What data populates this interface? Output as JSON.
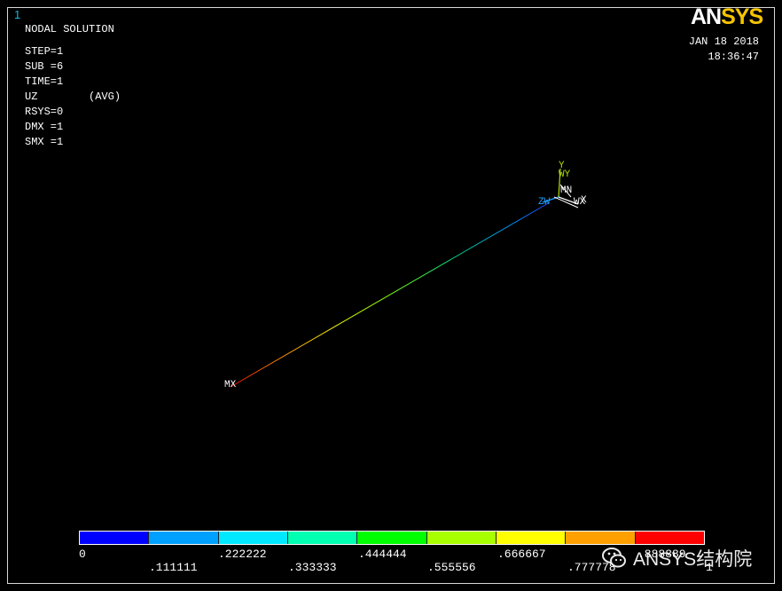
{
  "window": {
    "number": "1"
  },
  "info": {
    "title": "NODAL SOLUTION",
    "lines": [
      "STEP=1",
      "SUB =6",
      "TIME=1",
      "UZ        (AVG)",
      "RSYS=0",
      "DMX =1",
      "SMX =1"
    ]
  },
  "brand": {
    "logo_white": "AN",
    "logo_yellow": "SYS"
  },
  "datetime": {
    "date": "JAN 18 2018",
    "time": "18:36:47"
  },
  "markers": {
    "mx": "MX",
    "mn": "MN"
  },
  "triad": {
    "y": "Y",
    "wy": "WY",
    "zw": "ZW",
    "x": "X",
    "wx": "WX"
  },
  "legend": {
    "colors": [
      "#0000ff",
      "#00a0ff",
      "#00e8ff",
      "#00ffb0",
      "#00ff00",
      "#a8ff00",
      "#ffff00",
      "#ffa000",
      "#ff0000"
    ],
    "top_labels": [
      "0",
      ".222222",
      ".444444",
      ".666667",
      ".888889"
    ],
    "bottom_labels": [
      ".111111",
      ".333333",
      ".555556",
      ".777778",
      "1"
    ]
  },
  "watermark": {
    "text": "ANSYS结构院",
    "icon": "wechat-icon"
  }
}
